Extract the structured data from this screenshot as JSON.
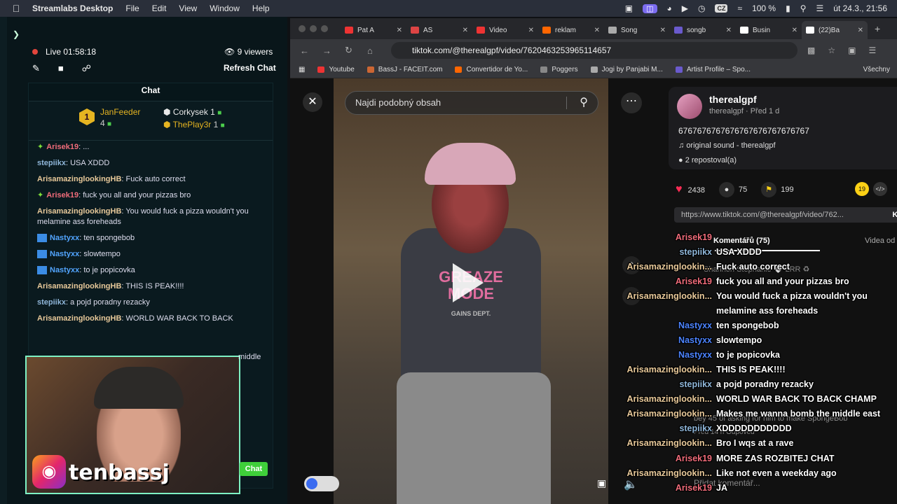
{
  "menubar": {
    "apple": "",
    "app": "Streamlabs Desktop",
    "items": [
      "File",
      "Edit",
      "View",
      "Window",
      "Help"
    ],
    "keyboard": "CZ",
    "battery": "100 %",
    "datetime": "út 24.3.",
    "time": "21:56"
  },
  "streamlabs": {
    "live_label": "Live",
    "live_time": "01:58:18",
    "viewers": "9 viewers",
    "refresh": "Refresh Chat",
    "chat_title": "Chat",
    "leaders": [
      {
        "name": "JanFeeder",
        "count": "4",
        "rank": "1"
      },
      {
        "name": "Corkysek",
        "count": "1"
      },
      {
        "name": "ThePlay3r",
        "count": "1"
      }
    ],
    "messages": [
      {
        "user": "Arisek19",
        "text": "...",
        "style": "red",
        "icon": "gem"
      },
      {
        "user": "stepiikx",
        "text": "USA XDDD",
        "style": "blue"
      },
      {
        "user": "ArisamazinglookingHB",
        "text": "Fuck auto correct",
        "style": "gold"
      },
      {
        "user": "Arisek19",
        "text": "fuck you all and your pizzas bro",
        "style": "red",
        "icon": "gem"
      },
      {
        "user": "ArisamazinglookingHB",
        "text": "You would fuck a pizza wouldn't you melamine ass foreheads",
        "style": "gold"
      },
      {
        "user": "Nastyxx",
        "text": "ten spongebob",
        "style": "nast",
        "icon": "box"
      },
      {
        "user": "Nastyxx",
        "text": "slowtempo",
        "style": "nast",
        "icon": "box"
      },
      {
        "user": "Nastyxx",
        "text": "to je popicovka",
        "style": "nast",
        "icon": "box"
      },
      {
        "user": "ArisamazinglookingHB",
        "text": "THIS IS PEAK!!!!",
        "style": "gold"
      },
      {
        "user": "stepiikx",
        "text": "a pojd poradny rezacky",
        "style": "blue"
      },
      {
        "user": "ArisamazinglookingHB",
        "text": "WORLD WAR BACK TO BACK",
        "style": "gold"
      }
    ],
    "cam_handle": "tenbassj",
    "chat_button": "Chat",
    "partial_text": "middle"
  },
  "browser": {
    "tabs": [
      {
        "label": "Pat A",
        "color": "#e33"
      },
      {
        "label": "AS",
        "color": "#d44"
      },
      {
        "label": "Video",
        "color": "#e33"
      },
      {
        "label": "reklam",
        "color": "#f60"
      },
      {
        "label": "Song",
        "color": "#aaa"
      },
      {
        "label": "songb",
        "color": "#6a5acd"
      },
      {
        "label": "Busin",
        "color": "#fff"
      },
      {
        "label": "(22)Ba",
        "color": "#fff",
        "active": true
      }
    ],
    "url": "tiktok.com/@therealgpf/video/7620463253965114657",
    "bookmarks": [
      {
        "label": "Youtube",
        "color": "#e33"
      },
      {
        "label": "BassJ - FACEIT.com",
        "color": "#c63"
      },
      {
        "label": "Convertidor de Yo...",
        "color": "#f60"
      },
      {
        "label": "Poggers",
        "color": "#888"
      },
      {
        "label": "Jogi by Panjabi M...",
        "color": "#aaa"
      },
      {
        "label": "Artist Profile – Spo...",
        "color": "#6a5acd"
      }
    ],
    "bookmarks_more": "Všechny"
  },
  "tiktok": {
    "search_placeholder": "Najdi podobný obsah",
    "username": "therealgpf",
    "subline": "therealgpf · Před 1 d",
    "description": "6767676767676767676767676767",
    "sound": "original sound - therealgpf",
    "reposts": "2 repostoval(a)",
    "likes": "2438",
    "comments": "75",
    "saves": "199",
    "share_badge": "19",
    "link": "https://www.tiktok.com/@therealgpf/video/762...",
    "link_btn": "Ko",
    "comments_tab": "Komentářů (75)",
    "videos_tab": "Videa od",
    "ghost_1": "Shannon Stephanie 🤍 LRR ♻",
    "ghost_2": "bey 45 of asking for him to make SpongeBob",
    "ghost_3": "Před 14 h    Odpověď",
    "add_comment": "Přidat komentář...",
    "video_shirt": "GREAZE MODE",
    "video_shirt_sub": "GAINS DEPT."
  },
  "overlay": [
    {
      "user": "Arisek19",
      "text": "",
      "style": "red"
    },
    {
      "user": "stepiikx",
      "text": "USA XDDD",
      "style": "blue"
    },
    {
      "user": "Arisamazinglookin...",
      "text": "Fuck auto correct",
      "style": "gold"
    },
    {
      "user": "Arisek19",
      "text": "fuck you all and your pizzas bro",
      "style": "red"
    },
    {
      "user": "Arisamazinglookin...",
      "text": "You would fuck a pizza wouldn't you",
      "style": "gold"
    },
    {
      "user": "",
      "text": "melamine ass foreheads",
      "style": "gold"
    },
    {
      "user": "Nastyxx",
      "text": "ten spongebob",
      "style": "nast"
    },
    {
      "user": "Nastyxx",
      "text": "slowtempo",
      "style": "nast"
    },
    {
      "user": "Nastyxx",
      "text": "to je popicovka",
      "style": "nast"
    },
    {
      "user": "Arisamazinglookin...",
      "text": "THIS IS PEAK!!!!",
      "style": "gold"
    },
    {
      "user": "stepiikx",
      "text": "a pojd poradny rezacky",
      "style": "blue"
    },
    {
      "user": "Arisamazinglookin...",
      "text": "WORLD WAR BACK TO BACK CHAMP",
      "style": "gold"
    },
    {
      "user": "Arisamazinglookin...",
      "text": "Makes me wanna bomb the middle east",
      "style": "gold"
    },
    {
      "user": "stepiikx",
      "text": "XDDDDDDDDDDD",
      "style": "blue"
    },
    {
      "user": "Arisamazinglookin...",
      "text": "Bro I wqs at a rave",
      "style": "gold"
    },
    {
      "user": "Arisek19",
      "text": "MORE ZAS ROZBITEJ CHAT",
      "style": "red"
    },
    {
      "user": "Arisamazinglookin...",
      "text": "Like not even a weekday ago",
      "style": "gold"
    },
    {
      "user": "Arisek19",
      "text": "JA",
      "style": "red"
    }
  ]
}
